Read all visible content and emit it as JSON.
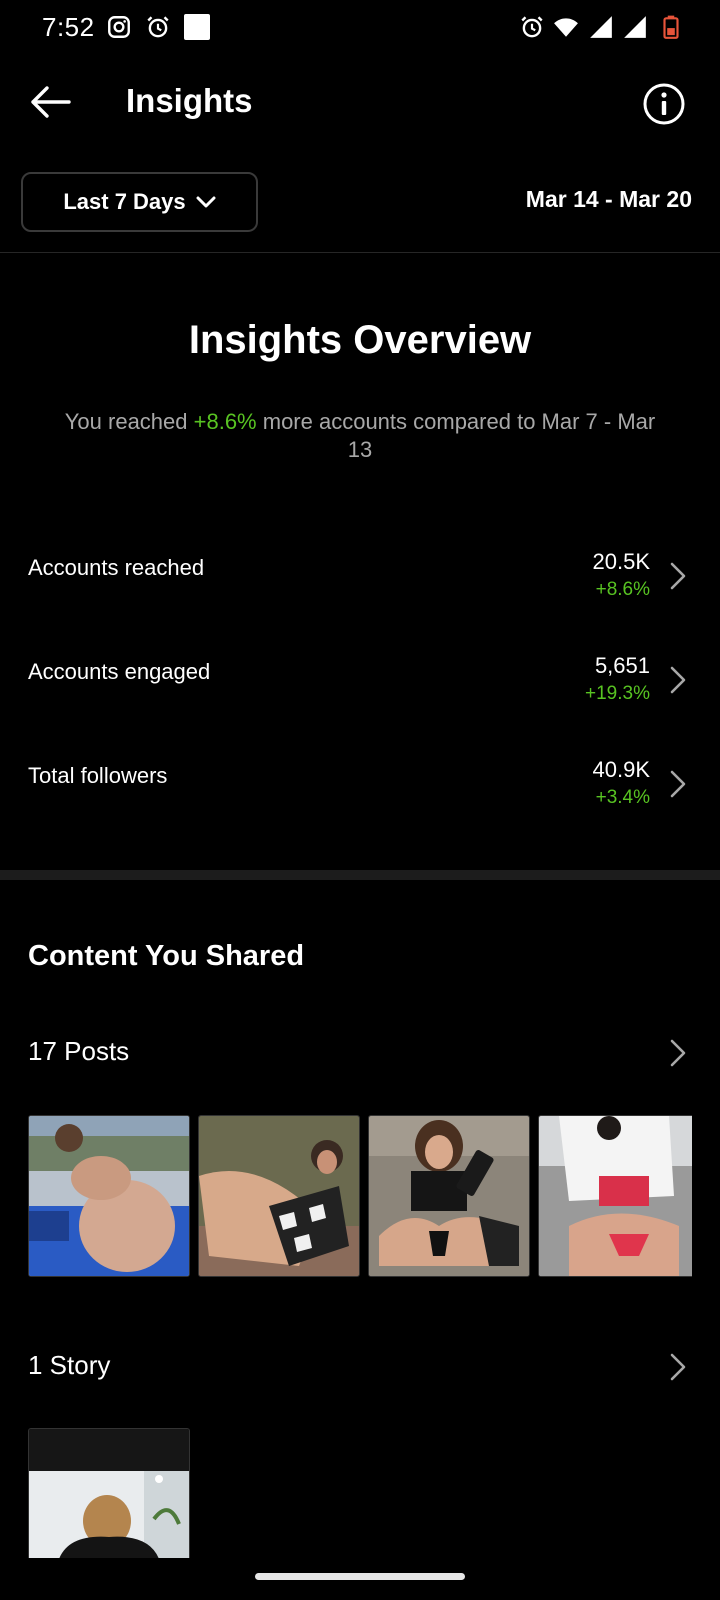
{
  "status_bar": {
    "time": "7:52",
    "left_icons": [
      "instagram-icon",
      "alarm-icon",
      "notification-square-icon"
    ],
    "right_icons": [
      "alarm-icon",
      "wifi-icon",
      "signal-icon",
      "signal-icon",
      "battery-icon"
    ],
    "battery_color": "#e8543a"
  },
  "header": {
    "title": "Insights"
  },
  "filter": {
    "range_label": "Last 7 Days",
    "date_range": "Mar 14 - Mar 20"
  },
  "overview": {
    "title": "Insights Overview",
    "sub_before": "You reached ",
    "sub_highlight": "+8.6%",
    "sub_after": " more accounts compared to Mar 7 - Mar 13"
  },
  "metrics": [
    {
      "label": "Accounts reached",
      "value": "20.5K",
      "delta": "+8.6%"
    },
    {
      "label": "Accounts engaged",
      "value": "5,651",
      "delta": "+19.3%"
    },
    {
      "label": "Total followers",
      "value": "40.9K",
      "delta": "+3.4%"
    }
  ],
  "content": {
    "title": "Content You Shared",
    "posts_label": "17 Posts",
    "story_label": "1 Story"
  },
  "colors": {
    "background": "#000000",
    "positive": "#58c322",
    "muted_text": "#a8a8a8"
  }
}
